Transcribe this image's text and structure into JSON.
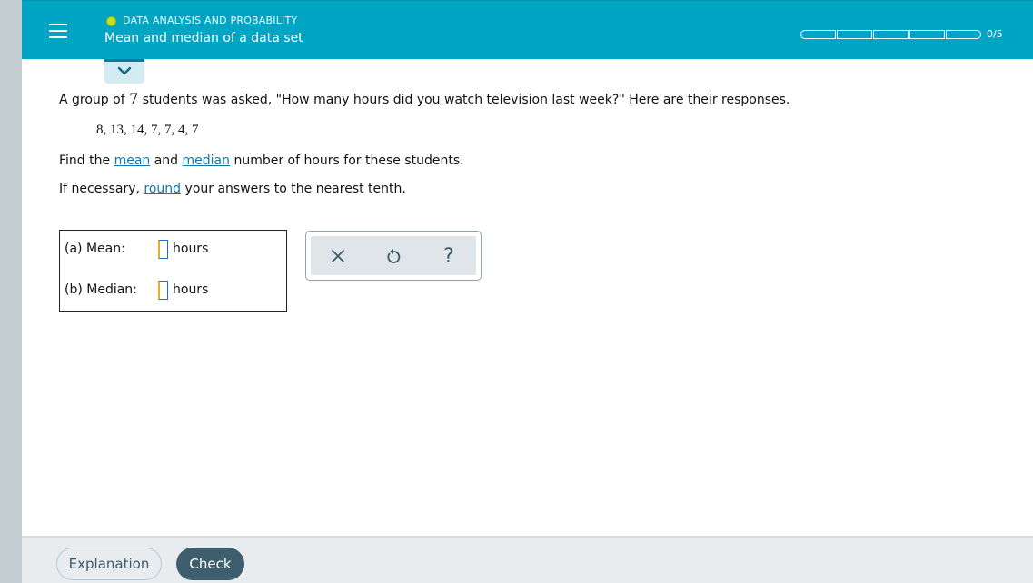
{
  "header": {
    "topic": "DATA ANALYSIS AND PROBABILITY",
    "title": "Mean and median of a data set",
    "progress_text": "0/5",
    "progress_segments": 5,
    "progress_completed": 0
  },
  "question": {
    "intro_pre": "A group of ",
    "count": "7",
    "intro_post": " students was asked, \"How many hours did you watch television last week?\" Here are their responses.",
    "data_list": "8, 13, 14, 7, 7, 4, 7",
    "find_pre": "Find the ",
    "mean_link": "mean",
    "find_mid": " and ",
    "median_link": "median",
    "find_post": " number of hours for these students.",
    "round_pre": "If necessary, ",
    "round_link": "round",
    "round_post": " your answers to the nearest tenth."
  },
  "answers": {
    "mean_label": "(a) Mean:",
    "median_label": "(b) Median:",
    "unit": "hours",
    "mean_value": "",
    "median_value": ""
  },
  "tools": {
    "close": "x-icon",
    "undo": "undo-icon",
    "help": "?"
  },
  "footer": {
    "explanation_label": "Explanation",
    "check_label": "Check"
  },
  "colors": {
    "header_bg": "#00a5c4",
    "link": "#1476a8",
    "check_button": "#3e5e6e",
    "topic_dot": "#c8e11e"
  }
}
